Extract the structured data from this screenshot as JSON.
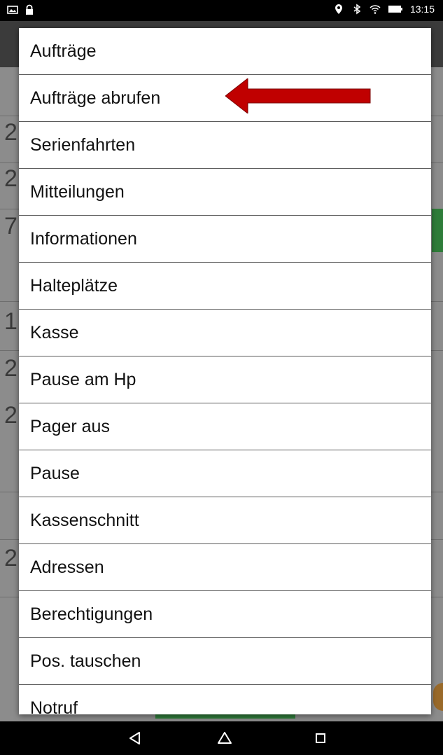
{
  "status_bar": {
    "time": "13:15",
    "left_icons": [
      "image-icon",
      "lock-icon"
    ],
    "right_icons": [
      "location-icon",
      "bluetooth-icon",
      "wifi-icon",
      "battery-icon"
    ]
  },
  "background_app": {
    "row_digits": [
      "2",
      "2",
      "7",
      "1",
      "2",
      "2",
      "2"
    ]
  },
  "menu": {
    "items": [
      {
        "label": "Aufträge"
      },
      {
        "label": "Aufträge abrufen"
      },
      {
        "label": "Serienfahrten"
      },
      {
        "label": "Mitteilungen"
      },
      {
        "label": "Informationen"
      },
      {
        "label": "Halteplätze"
      },
      {
        "label": "Kasse"
      },
      {
        "label": "Pause am Hp"
      },
      {
        "label": "Pager aus"
      },
      {
        "label": "Pause"
      },
      {
        "label": "Kassenschnitt"
      },
      {
        "label": "Adressen"
      },
      {
        "label": "Berechtigungen"
      },
      {
        "label": "Pos. tauschen"
      },
      {
        "label": "Notruf"
      }
    ],
    "highlight_arrow_color": "#c00000"
  },
  "nav_bar": {
    "buttons": [
      "back-icon",
      "home-icon",
      "recents-icon"
    ]
  }
}
